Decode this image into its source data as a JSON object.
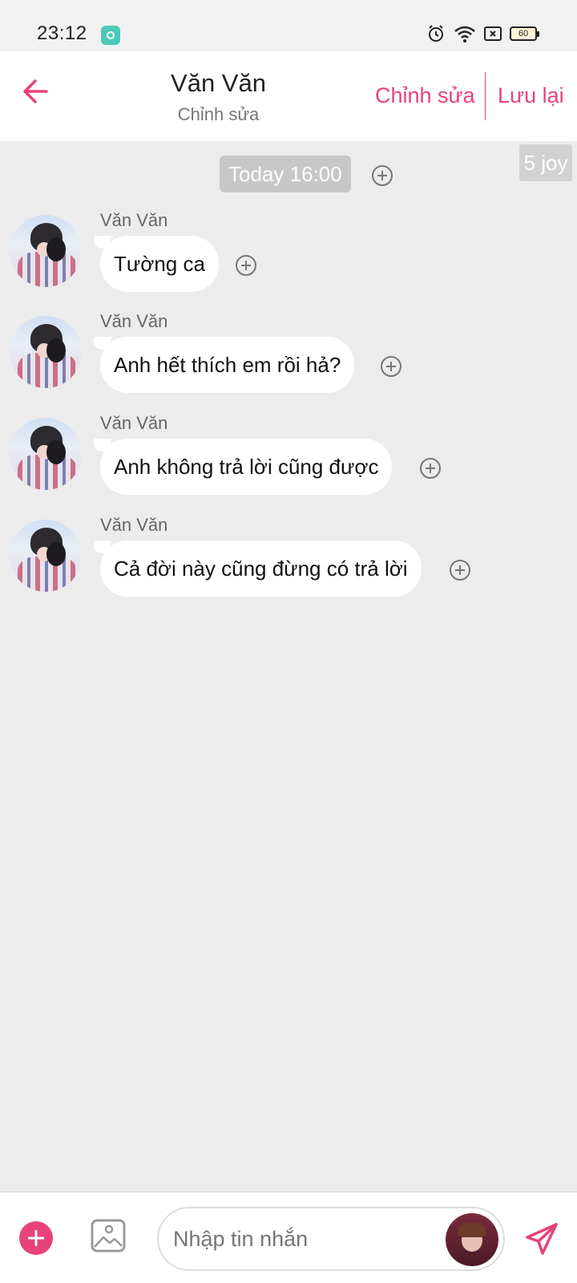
{
  "status_bar": {
    "time": "23:12",
    "battery": "60"
  },
  "header": {
    "title": "Văn Văn",
    "subtitle": "Chỉnh sửa",
    "edit_label": "Chỉnh sửa",
    "save_label": "Lưu lại"
  },
  "joy_badge": "5 joy",
  "timestamp": "Today 16:00",
  "messages": [
    {
      "sender": "Văn Văn",
      "text": "Tường ca"
    },
    {
      "sender": "Văn Văn",
      "text": "Anh hết thích em rồi hả?"
    },
    {
      "sender": "Văn Văn",
      "text": "Anh không trả lời cũng được"
    },
    {
      "sender": "Văn Văn",
      "text": "Cả đời này cũng đừng có trả lời"
    }
  ],
  "composer": {
    "placeholder": "Nhập tin nhắn"
  },
  "colors": {
    "accent": "#e8427a",
    "background": "#ececec",
    "bubble": "#ffffff"
  }
}
